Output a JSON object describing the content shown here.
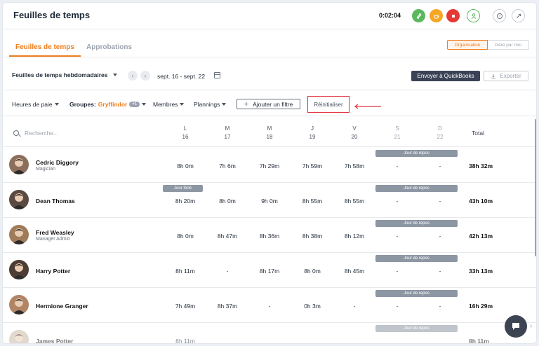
{
  "header": {
    "title": "Feuilles de temps",
    "timer": "0:02:04",
    "colors": {
      "green": "#5cb85c",
      "orange": "#f5a623",
      "red": "#e53935"
    }
  },
  "tabs": {
    "active": "Feuilles de temps",
    "inactive": "Approbations"
  },
  "segmented": {
    "org": "Organisation",
    "managed": "Géré par moi"
  },
  "toolbar": {
    "period": "Feuilles de temps hebdomadaires",
    "daterange": "sept. 16 - sept. 22",
    "quickbooks": "Envoyer à QuickBooks",
    "export": "Exporter"
  },
  "filters": {
    "paie": "Heures de paie",
    "groups_label": "Groupes:",
    "groups_value": "Gryffindor",
    "groups_extra": "+1",
    "members": "Membres",
    "plannings": "Plannings",
    "add_filter": "Ajouter un filtre",
    "reset": "Réinitialiser"
  },
  "table": {
    "search_placeholder": "Recherche...",
    "days": [
      {
        "l": "L",
        "d": "16"
      },
      {
        "l": "M",
        "d": "17"
      },
      {
        "l": "M",
        "d": "18"
      },
      {
        "l": "J",
        "d": "19"
      },
      {
        "l": "V",
        "d": "20"
      },
      {
        "l": "S",
        "d": "21"
      },
      {
        "l": "D",
        "d": "22"
      }
    ],
    "total_label": "Total",
    "tag_repos": "Jour de repos",
    "tag_ferie": "Jour férié",
    "rows": [
      {
        "name": "Cedric Diggory",
        "role": "Magician",
        "cells": [
          "8h 0m",
          "7h 6m",
          "7h 29m",
          "7h 59m",
          "7h 58m",
          "-",
          "-"
        ],
        "total": "38h 32m",
        "ferie": false
      },
      {
        "name": "Dean Thomas",
        "role": "",
        "cells": [
          "8h 20m",
          "8h 0m",
          "9h 0m",
          "8h 55m",
          "8h 55m",
          "-",
          "-"
        ],
        "total": "43h 10m",
        "ferie": true
      },
      {
        "name": "Fred Weasley",
        "role": "Manager Admin",
        "cells": [
          "8h 0m",
          "8h 47m",
          "8h 36m",
          "8h 38m",
          "8h 12m",
          "-",
          "-"
        ],
        "total": "42h 13m",
        "ferie": false
      },
      {
        "name": "Harry Potter",
        "role": "",
        "cells": [
          "8h 11m",
          "-",
          "8h 17m",
          "8h 0m",
          "8h 45m",
          "-",
          "-"
        ],
        "total": "33h 13m",
        "ferie": false
      },
      {
        "name": "Hermione Granger",
        "role": "",
        "cells": [
          "7h 49m",
          "8h 37m",
          "-",
          "0h 3m",
          "-",
          "-",
          "-"
        ],
        "total": "16h 29m",
        "ferie": false
      },
      {
        "name": "James Potter",
        "role": "",
        "cells": [
          "8h 11m",
          "",
          "",
          "",
          "",
          "",
          ""
        ],
        "total": "8h 11m",
        "ferie": false
      }
    ]
  }
}
